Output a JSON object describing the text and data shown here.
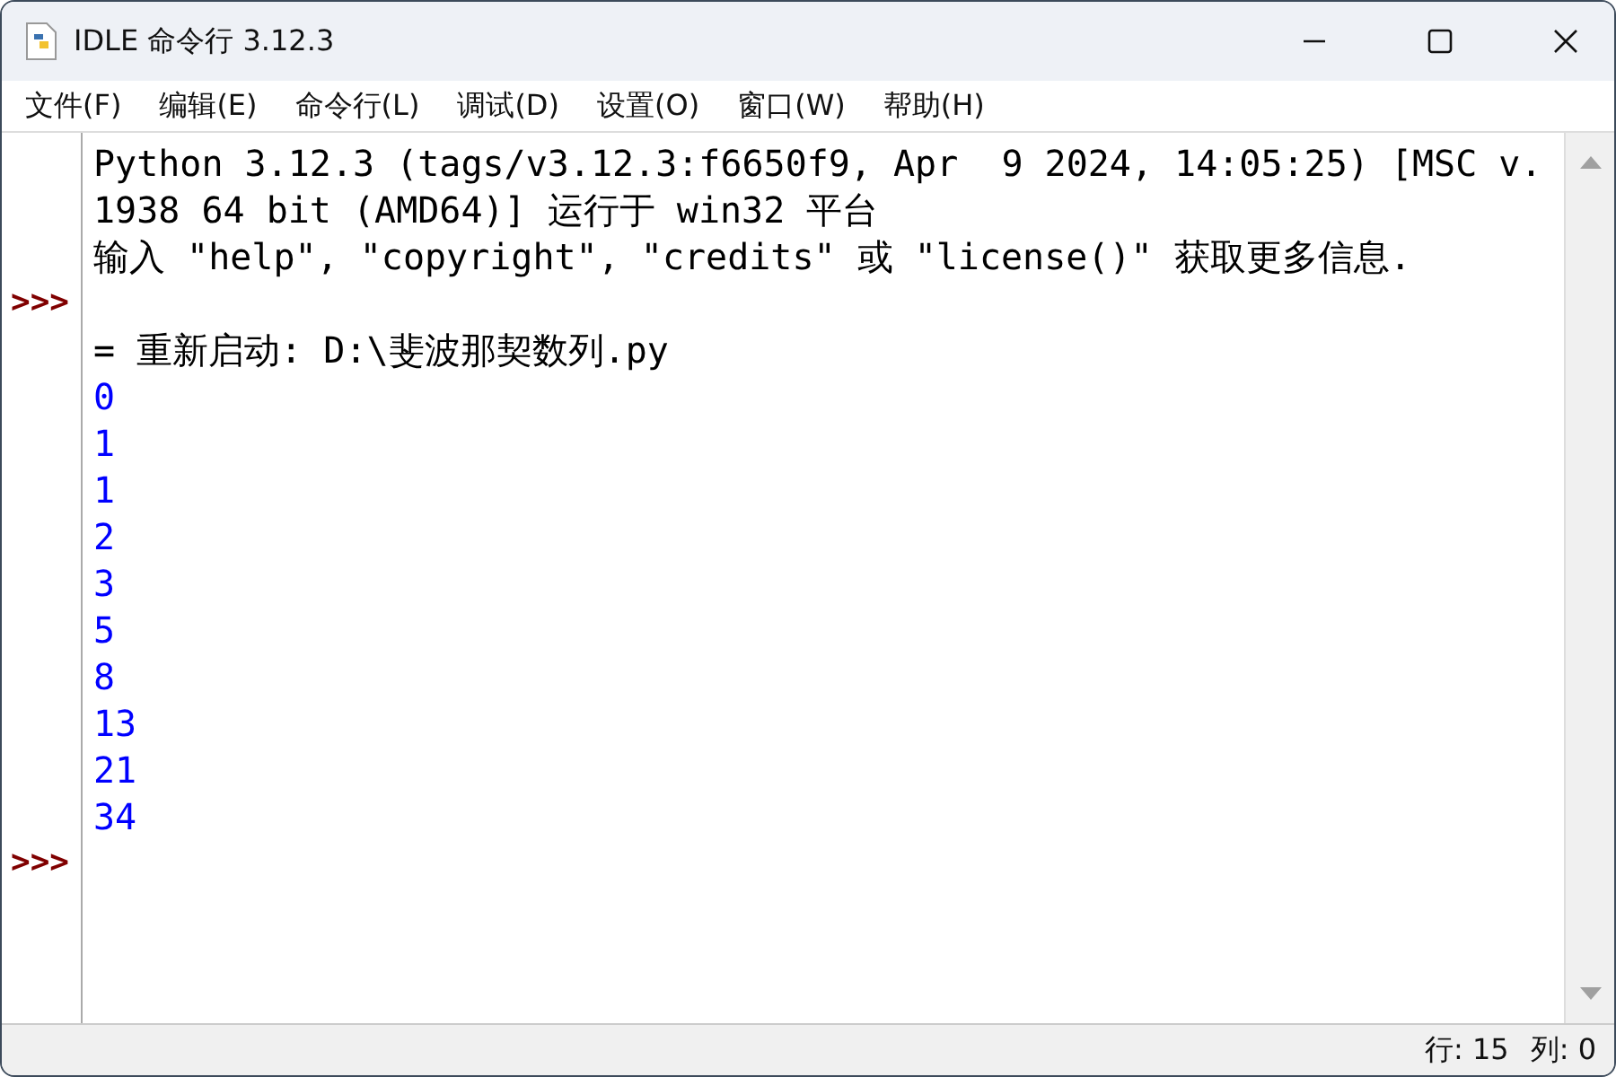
{
  "window": {
    "title": "IDLE 命令行 3.12.3"
  },
  "menu": [
    "文件(F)",
    "编辑(E)",
    "命令行(L)",
    "调试(D)",
    "设置(O)",
    "窗口(W)",
    "帮助(H)"
  ],
  "shell": {
    "lines": [
      {
        "kind": "output",
        "text": "Python 3.12.3 (tags/v3.12.3:f6650f9, Apr  9 2024, 14:05:25) [MSC v."
      },
      {
        "kind": "output",
        "text": "1938 64 bit (AMD64)] 运行于 win32 平台"
      },
      {
        "kind": "output",
        "text": "输入 \"help\", \"copyright\", \"credits\" 或 \"license()\" 获取更多信息."
      },
      {
        "kind": "prompt",
        "prompt": ">>>"
      },
      {
        "kind": "output",
        "text": "= 重新启动: D:\\斐波那契数列.py"
      },
      {
        "kind": "stdout",
        "text": "0"
      },
      {
        "kind": "stdout",
        "text": "1"
      },
      {
        "kind": "stdout",
        "text": "1"
      },
      {
        "kind": "stdout",
        "text": "2"
      },
      {
        "kind": "stdout",
        "text": "3"
      },
      {
        "kind": "stdout",
        "text": "5"
      },
      {
        "kind": "stdout",
        "text": "8"
      },
      {
        "kind": "stdout",
        "text": "13"
      },
      {
        "kind": "stdout",
        "text": "21"
      },
      {
        "kind": "stdout",
        "text": "34"
      },
      {
        "kind": "prompt",
        "prompt": ">>>"
      }
    ]
  },
  "status_bar": {
    "line": "行: 15",
    "column": "列: 0"
  }
}
